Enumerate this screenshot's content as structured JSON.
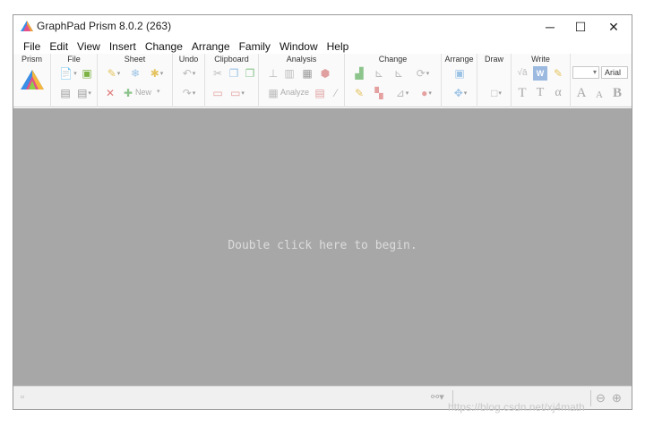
{
  "window": {
    "title": "GraphPad Prism 8.0.2 (263)",
    "controls": {
      "minimize": "─",
      "maximize": "☐",
      "close": "✕"
    }
  },
  "menubar": [
    "File",
    "Edit",
    "View",
    "Insert",
    "Change",
    "Arrange",
    "Family",
    "Window",
    "Help"
  ],
  "ribbon": {
    "groups": {
      "prism": "Prism",
      "file": "File",
      "sheet": "Sheet",
      "undo": "Undo",
      "clipboard": "Clipboard",
      "analysis": "Analysis",
      "change": "Change",
      "arrange": "Arrange",
      "draw": "Draw",
      "write": "Write"
    },
    "sheet_new_label": "New",
    "analysis_analyze_label": "Analyze",
    "write_glyphs": {
      "sqrt": "√ā",
      "word": "W",
      "t1": "T",
      "t2": "T",
      "alpha": "α",
      "a_big": "A",
      "a_small": "A",
      "bold": "B"
    },
    "font_name": "Arial",
    "font_size": ""
  },
  "workspace": {
    "prompt": "Double click here to begin."
  },
  "watermark": "https://blog.csdn.net/xj4math",
  "colors": {
    "workspace_bg": "#a8a7a8",
    "ribbon_bg": "#fafafa",
    "statusbar_bg": "#f0f0f0"
  },
  "icons": [
    "prism-logo-icon",
    "new-file-icon",
    "open-file-icon",
    "save-icon",
    "save-as-icon",
    "undo-icon",
    "redo-icon",
    "cut-icon",
    "copy-icon",
    "paste-icon",
    "delete-icon",
    "new-sheet-icon",
    "analyze-icon",
    "link-icon",
    "zoom-out-icon",
    "zoom-in-icon"
  ]
}
